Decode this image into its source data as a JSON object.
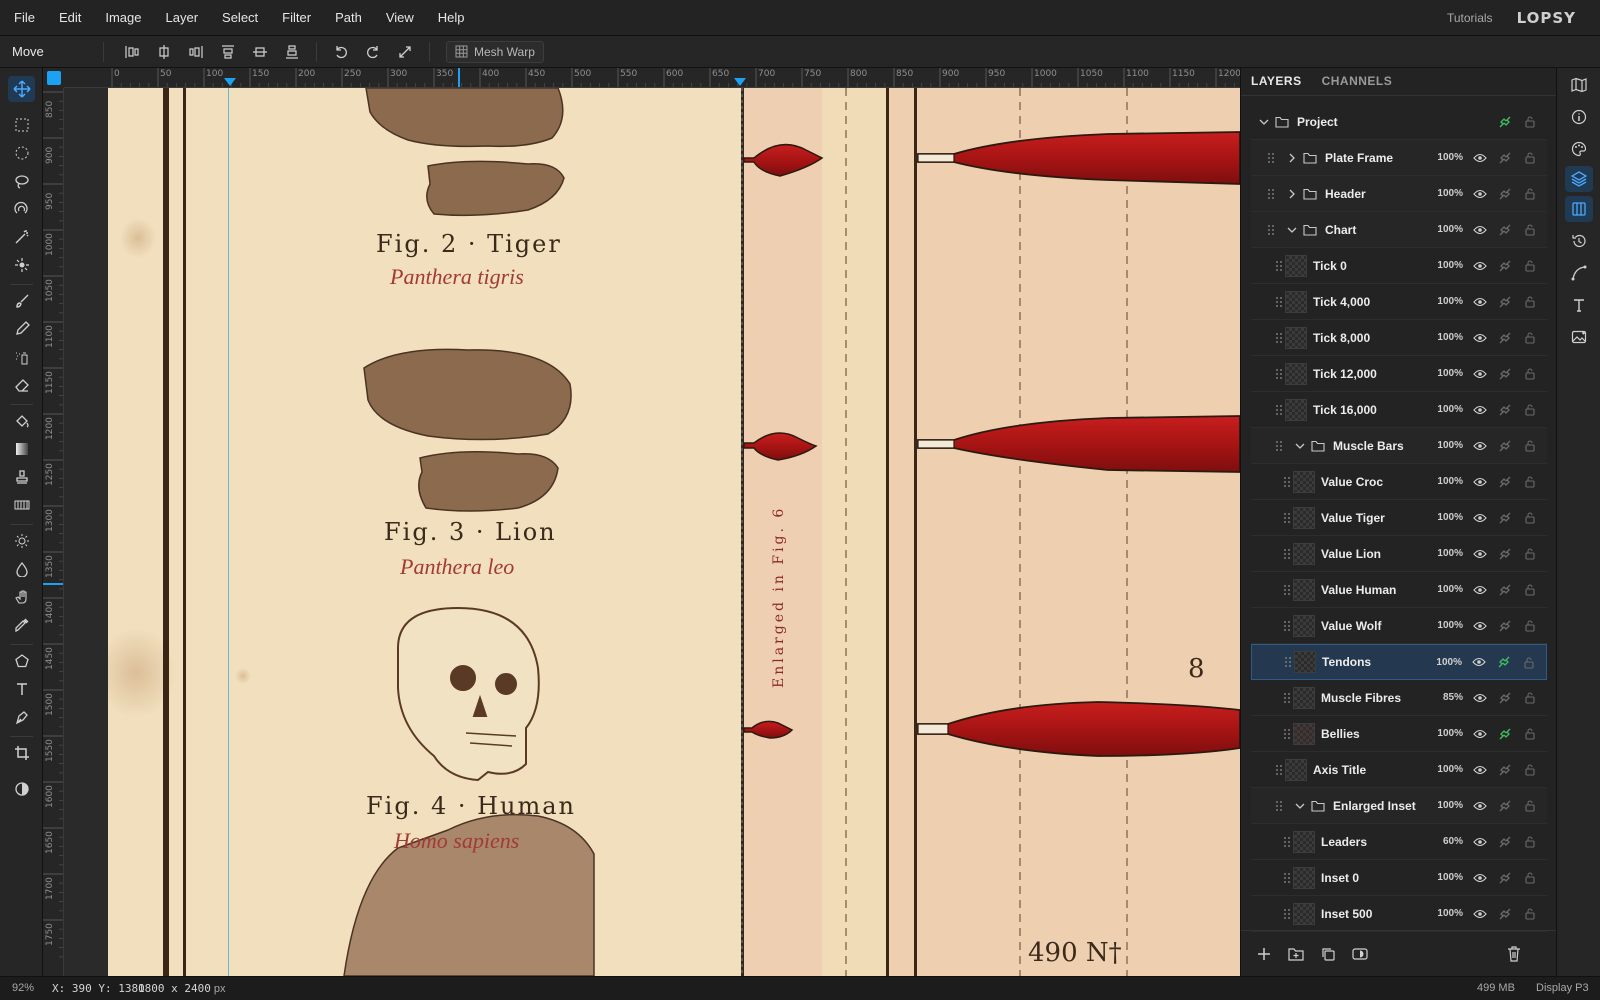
{
  "menu": {
    "items": [
      "File",
      "Edit",
      "Image",
      "Layer",
      "Select",
      "Filter",
      "Path",
      "View",
      "Help"
    ],
    "tutorials": "Tutorials",
    "brand": "LOPSY"
  },
  "options": {
    "tool_name": "Move",
    "mesh_warp": "Mesh Warp"
  },
  "rulers": {
    "horizontal": [
      "0",
      "50",
      "100",
      "150",
      "200",
      "250",
      "300",
      "350",
      "400",
      "450",
      "500",
      "550",
      "600",
      "650",
      "700",
      "750",
      "800",
      "850",
      "900",
      "950",
      "1000",
      "1050",
      "1100",
      "1150",
      "1200"
    ],
    "vertical": [
      "850",
      "900",
      "950",
      "1000",
      "1050",
      "1100",
      "1150",
      "1200",
      "1250",
      "1300",
      "1350",
      "1400",
      "1450",
      "1500",
      "1550",
      "1600",
      "1650",
      "1700",
      "1750"
    ]
  },
  "canvas": {
    "figures": [
      {
        "title": "Fig. 2 · Tiger",
        "latin": "Panthera tigris"
      },
      {
        "title": "Fig. 3 · Lion",
        "latin": "Panthera leo"
      },
      {
        "title": "Fig. 4 · Human",
        "latin": "Homo sapiens"
      }
    ],
    "inset_label": "Enlarged in Fig. 6",
    "value_partial": "8",
    "value_bottom": "490 N†"
  },
  "panel": {
    "tabs": [
      "LAYERS",
      "CHANNELS"
    ],
    "layers": [
      {
        "name": "Project",
        "opacity": "",
        "kind": "group-open",
        "indent": 0,
        "linked": true
      },
      {
        "name": "Plate Frame",
        "opacity": "100%",
        "kind": "group-closed",
        "indent": 1,
        "linked": false
      },
      {
        "name": "Header",
        "opacity": "100%",
        "kind": "group-closed",
        "indent": 1,
        "linked": false
      },
      {
        "name": "Chart",
        "opacity": "100%",
        "kind": "group-open",
        "indent": 1,
        "linked": false
      },
      {
        "name": "Tick 0",
        "opacity": "100%",
        "kind": "layer",
        "indent": 2,
        "linked": false
      },
      {
        "name": "Tick 4,000",
        "opacity": "100%",
        "kind": "layer",
        "indent": 2,
        "linked": false
      },
      {
        "name": "Tick 8,000",
        "opacity": "100%",
        "kind": "layer",
        "indent": 2,
        "linked": false
      },
      {
        "name": "Tick 12,000",
        "opacity": "100%",
        "kind": "layer",
        "indent": 2,
        "linked": false
      },
      {
        "name": "Tick 16,000",
        "opacity": "100%",
        "kind": "layer",
        "indent": 2,
        "linked": false
      },
      {
        "name": "Muscle Bars",
        "opacity": "100%",
        "kind": "group-open",
        "indent": 2,
        "linked": false
      },
      {
        "name": "Value Croc",
        "opacity": "100%",
        "kind": "layer",
        "indent": 3,
        "linked": false
      },
      {
        "name": "Value Tiger",
        "opacity": "100%",
        "kind": "layer",
        "indent": 3,
        "linked": false
      },
      {
        "name": "Value Lion",
        "opacity": "100%",
        "kind": "layer",
        "indent": 3,
        "linked": false
      },
      {
        "name": "Value Human",
        "opacity": "100%",
        "kind": "layer",
        "indent": 3,
        "linked": false
      },
      {
        "name": "Value Wolf",
        "opacity": "100%",
        "kind": "layer",
        "indent": 3,
        "linked": false
      },
      {
        "name": "Tendons",
        "opacity": "100%",
        "kind": "layer",
        "indent": 3,
        "linked": true,
        "selected": true
      },
      {
        "name": "Muscle Fibres",
        "opacity": "85%",
        "kind": "layer",
        "indent": 3,
        "linked": false
      },
      {
        "name": "Bellies",
        "opacity": "100%",
        "kind": "layer-red",
        "indent": 3,
        "linked": true
      },
      {
        "name": "Axis Title",
        "opacity": "100%",
        "kind": "layer",
        "indent": 2,
        "linked": false
      },
      {
        "name": "Enlarged Inset",
        "opacity": "100%",
        "kind": "group-open",
        "indent": 2,
        "linked": false
      },
      {
        "name": "Leaders",
        "opacity": "60%",
        "kind": "layer",
        "indent": 3,
        "linked": false
      },
      {
        "name": "Inset 0",
        "opacity": "100%",
        "kind": "layer",
        "indent": 3,
        "linked": false
      },
      {
        "name": "Inset 500",
        "opacity": "100%",
        "kind": "layer",
        "indent": 3,
        "linked": false
      }
    ]
  },
  "status": {
    "zoom": "92%",
    "coords": "X: 390 Y: 1380",
    "dimensions": "1800 x 2400",
    "unit": "px",
    "memory": "499 MB",
    "display": "Display P3"
  },
  "colors": {
    "accent": "#1da1f2",
    "selection": "#24384f",
    "link_green": "#3fbf5f",
    "muscle_red": "#b01818",
    "parchment": "#f2e2c0"
  }
}
